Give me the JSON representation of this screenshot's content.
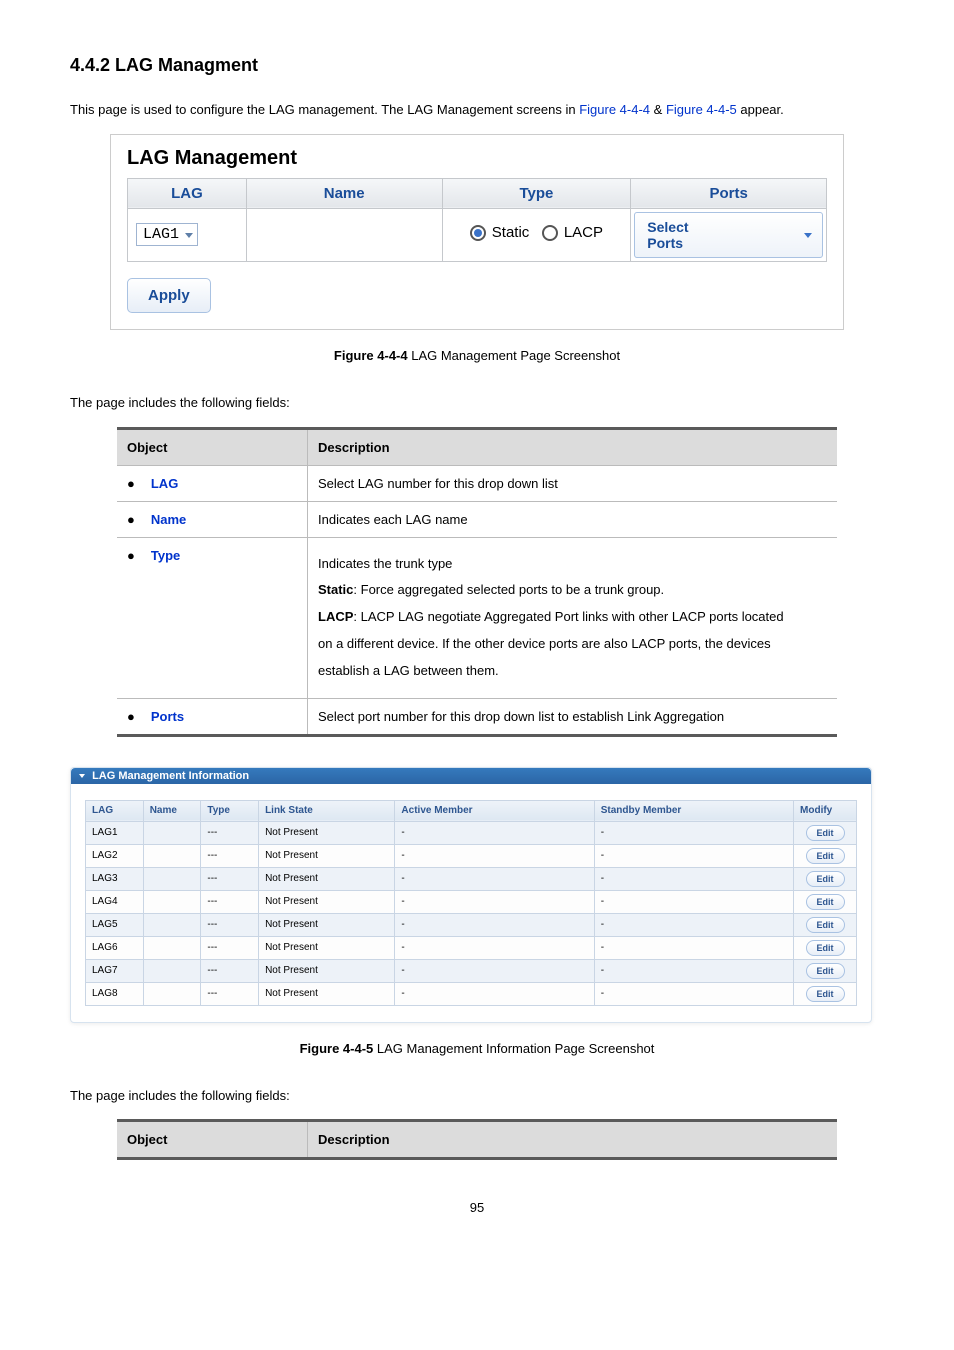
{
  "section_heading": "4.4.2 LAG Managment",
  "intro_pre": "This page is used to configure the LAG management. The LAG Management screens in ",
  "intro_link1": "Figure 4-4-4",
  "intro_amp": " & ",
  "intro_link2": "Figure 4-4-5",
  "intro_post": " appear.",
  "panel": {
    "title": "LAG Management",
    "headers": {
      "lag": "LAG",
      "name": "Name",
      "type": "Type",
      "ports": "Ports"
    },
    "lag_value": "LAG1",
    "type_static": "Static",
    "type_lacp": "LACP",
    "ports_label": "Select Ports",
    "apply": "Apply"
  },
  "fig1_bold": "Figure 4-4-4",
  "fig1_rest": " LAG Management Page Screenshot",
  "fields_intro": "The page includes the following fields:",
  "objtbl1": {
    "h_obj": "Object",
    "h_desc": "Description",
    "rows": [
      {
        "label": "LAG",
        "desc": "Select LAG number for this drop down list"
      },
      {
        "label": "Name",
        "desc": "Indicates each LAG name"
      }
    ],
    "type_label": "Type",
    "type_line1": "Indicates the trunk type",
    "type_static_b": "Static",
    "type_static_rest": ": Force aggregated selected ports to be a trunk group.",
    "type_lacp_b": "LACP",
    "type_lacp_rest1": ": LACP LAG negotiate Aggregated Port links with other LACP ports located",
    "type_lacp_rest2": "on a different device. If the other device ports are also LACP ports, the devices",
    "type_lacp_rest3": "establish a LAG between them.",
    "ports_label": "Ports",
    "ports_desc": "Select port number for this drop down list to establish Link Aggregation"
  },
  "info": {
    "header": "LAG Management Information",
    "cols": {
      "lag": "LAG",
      "name": "Name",
      "type": "Type",
      "link": "Link State",
      "act": "Active Member",
      "stb": "Standby Member",
      "mod": "Modify"
    },
    "edit": "Edit",
    "rows": [
      {
        "lag": "LAG1",
        "name": "",
        "type": "---",
        "link": "Not Present",
        "act": "-",
        "stb": "-"
      },
      {
        "lag": "LAG2",
        "name": "",
        "type": "---",
        "link": "Not Present",
        "act": "-",
        "stb": "-"
      },
      {
        "lag": "LAG3",
        "name": "",
        "type": "---",
        "link": "Not Present",
        "act": "-",
        "stb": "-"
      },
      {
        "lag": "LAG4",
        "name": "",
        "type": "---",
        "link": "Not Present",
        "act": "-",
        "stb": "-"
      },
      {
        "lag": "LAG5",
        "name": "",
        "type": "---",
        "link": "Not Present",
        "act": "-",
        "stb": "-"
      },
      {
        "lag": "LAG6",
        "name": "",
        "type": "---",
        "link": "Not Present",
        "act": "-",
        "stb": "-"
      },
      {
        "lag": "LAG7",
        "name": "",
        "type": "---",
        "link": "Not Present",
        "act": "-",
        "stb": "-"
      },
      {
        "lag": "LAG8",
        "name": "",
        "type": "---",
        "link": "Not Present",
        "act": "-",
        "stb": "-"
      }
    ]
  },
  "fig2_bold": "Figure 4-4-5",
  "fig2_rest": " LAG Management Information Page Screenshot",
  "fields_intro2": "The page includes the following fields:",
  "objtbl2": {
    "h_obj": "Object",
    "h_desc": "Description"
  },
  "page_number": "95"
}
